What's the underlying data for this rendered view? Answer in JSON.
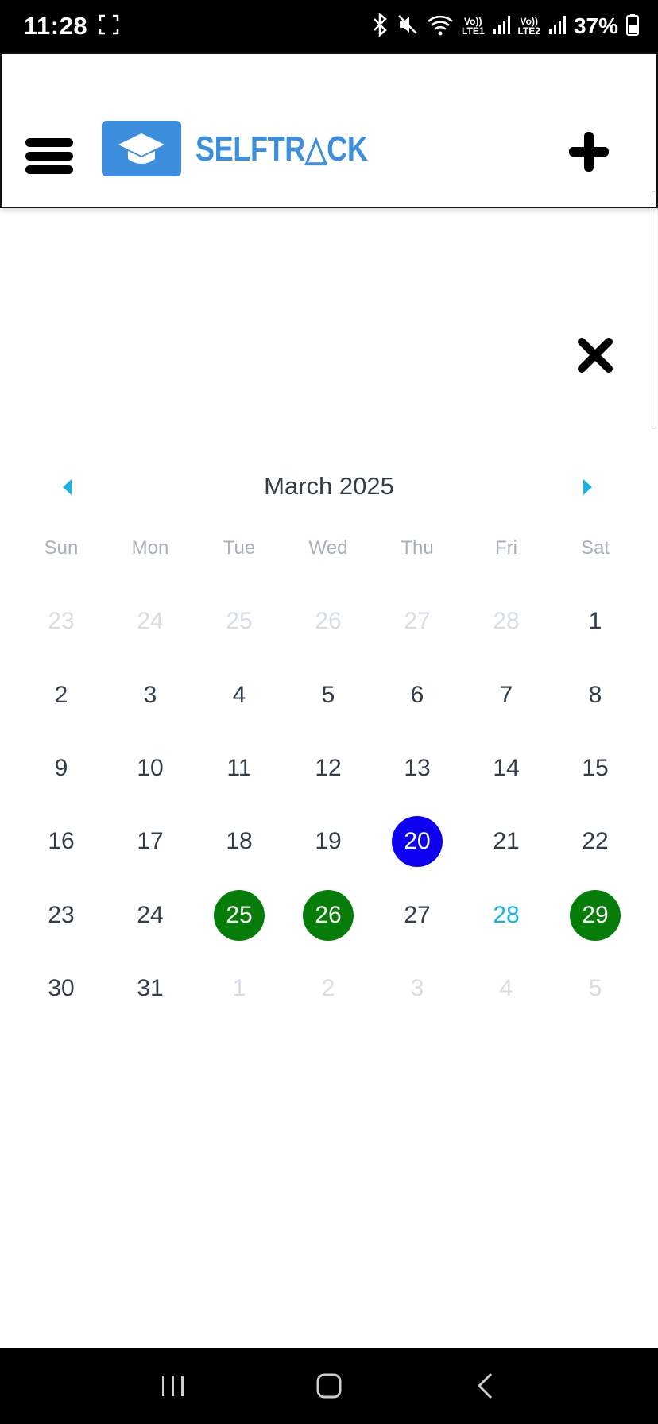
{
  "status_bar": {
    "time": "11:28",
    "lte1_top": "Vo))",
    "lte1_bottom": "LTE1",
    "lte2_top": "Vo))",
    "lte2_bottom": "LTE2",
    "battery": "37%"
  },
  "header": {
    "brand": "SELFTR△CK",
    "colors": {
      "brand": "#3d8fde"
    },
    "icons": [
      "menu-icon",
      "graduation-cap-icon",
      "plus-icon"
    ]
  },
  "calendar": {
    "month_title": "March 2025",
    "weekdays": [
      "Sun",
      "Mon",
      "Tue",
      "Wed",
      "Thu",
      "Fri",
      "Sat"
    ],
    "days": [
      {
        "label": "23",
        "state": "muted"
      },
      {
        "label": "24",
        "state": "muted"
      },
      {
        "label": "25",
        "state": "muted"
      },
      {
        "label": "26",
        "state": "muted"
      },
      {
        "label": "27",
        "state": "muted"
      },
      {
        "label": "28",
        "state": "muted"
      },
      {
        "label": "1",
        "state": "normal"
      },
      {
        "label": "2",
        "state": "normal"
      },
      {
        "label": "3",
        "state": "normal"
      },
      {
        "label": "4",
        "state": "normal"
      },
      {
        "label": "5",
        "state": "normal"
      },
      {
        "label": "6",
        "state": "normal"
      },
      {
        "label": "7",
        "state": "normal"
      },
      {
        "label": "8",
        "state": "normal"
      },
      {
        "label": "9",
        "state": "normal"
      },
      {
        "label": "10",
        "state": "normal"
      },
      {
        "label": "11",
        "state": "normal"
      },
      {
        "label": "12",
        "state": "normal"
      },
      {
        "label": "13",
        "state": "normal"
      },
      {
        "label": "14",
        "state": "normal"
      },
      {
        "label": "15",
        "state": "normal"
      },
      {
        "label": "16",
        "state": "normal"
      },
      {
        "label": "17",
        "state": "normal"
      },
      {
        "label": "18",
        "state": "normal"
      },
      {
        "label": "19",
        "state": "normal"
      },
      {
        "label": "20",
        "state": "today-blue"
      },
      {
        "label": "21",
        "state": "normal"
      },
      {
        "label": "22",
        "state": "normal"
      },
      {
        "label": "23",
        "state": "normal"
      },
      {
        "label": "24",
        "state": "normal"
      },
      {
        "label": "25",
        "state": "marked"
      },
      {
        "label": "26",
        "state": "marked"
      },
      {
        "label": "27",
        "state": "normal"
      },
      {
        "label": "28",
        "state": "highlight"
      },
      {
        "label": "29",
        "state": "marked"
      },
      {
        "label": "30",
        "state": "normal"
      },
      {
        "label": "31",
        "state": "normal"
      },
      {
        "label": "1",
        "state": "muted"
      },
      {
        "label": "2",
        "state": "muted"
      },
      {
        "label": "3",
        "state": "muted"
      },
      {
        "label": "4",
        "state": "muted"
      },
      {
        "label": "5",
        "state": "muted"
      }
    ],
    "colors": {
      "today": "#0d00f0",
      "marked": "#067d08",
      "highlight": "#19b2e6",
      "nav_arrow": "#19b2e6"
    }
  },
  "nav_bar": {
    "icons": [
      "recent-apps-icon",
      "home-icon",
      "back-icon"
    ]
  }
}
